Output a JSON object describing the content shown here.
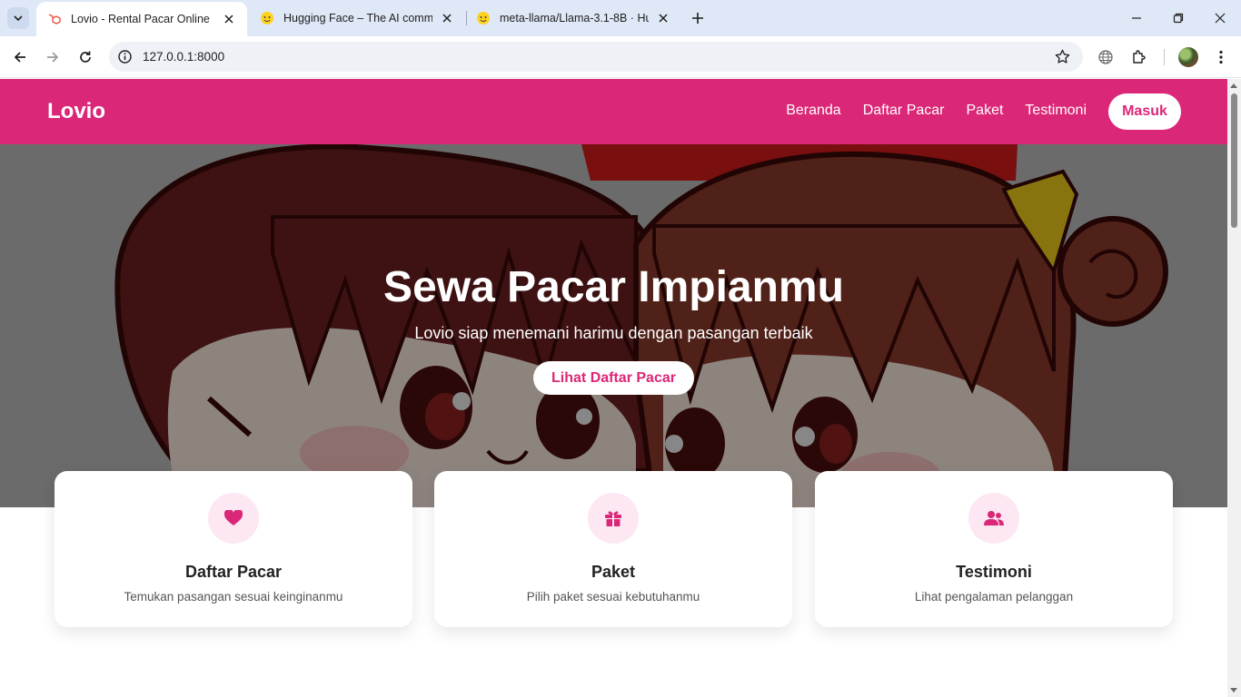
{
  "browser": {
    "tabs": [
      {
        "title": "Lovio - Rental Pacar Online",
        "active": true,
        "favicon": "laravel-icon"
      },
      {
        "title": "Hugging Face – The AI commun",
        "active": false,
        "favicon": "hugging-face-icon"
      },
      {
        "title": "meta-llama/Llama-3.1-8B · Hug",
        "active": false,
        "favicon": "hugging-face-icon"
      }
    ],
    "url": "127.0.0.1:8000"
  },
  "site": {
    "brand": "Lovio",
    "nav": [
      "Beranda",
      "Daftar Pacar",
      "Paket",
      "Testimoni"
    ],
    "login_label": "Masuk",
    "accent_color": "#db2777",
    "hero": {
      "title": "Sewa Pacar Impianmu",
      "subtitle": "Lovio siap menemani harimu dengan pasangan terbaik",
      "cta_label": "Lihat Daftar Pacar"
    },
    "features": [
      {
        "icon": "heart-icon",
        "title": "Daftar Pacar",
        "desc": "Temukan pasangan sesuai keinginanmu"
      },
      {
        "icon": "gift-icon",
        "title": "Paket",
        "desc": "Pilih paket sesuai kebutuhanmu"
      },
      {
        "icon": "users-icon",
        "title": "Testimoni",
        "desc": "Lihat pengalaman pelanggan"
      }
    ]
  }
}
